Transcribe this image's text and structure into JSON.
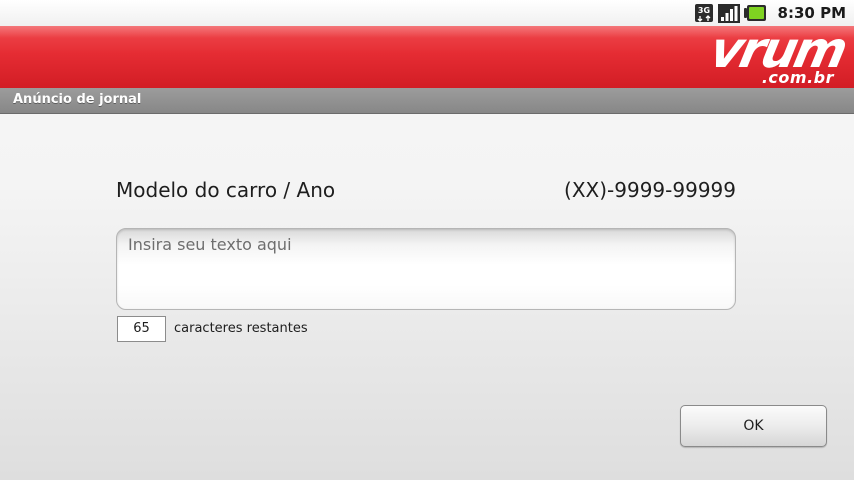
{
  "status_bar": {
    "time": "8:30 PM",
    "network_label": "3G",
    "icons": [
      "network-3g-icon",
      "signal-strength-icon",
      "battery-icon"
    ]
  },
  "brand": {
    "logo_text": "vrum",
    "logo_domain": ".com.br",
    "header_color": "#e52c33"
  },
  "title_bar": {
    "title": "Anúncio de jornal"
  },
  "ad_form": {
    "model_label": "Modelo do carro / Ano",
    "phone_label": "(XX)-9999-99999",
    "text_placeholder": "Insira seu texto aqui",
    "text_value": "",
    "remaining_count": "65",
    "remaining_label": "caracteres restantes",
    "ok_label": "OK"
  }
}
